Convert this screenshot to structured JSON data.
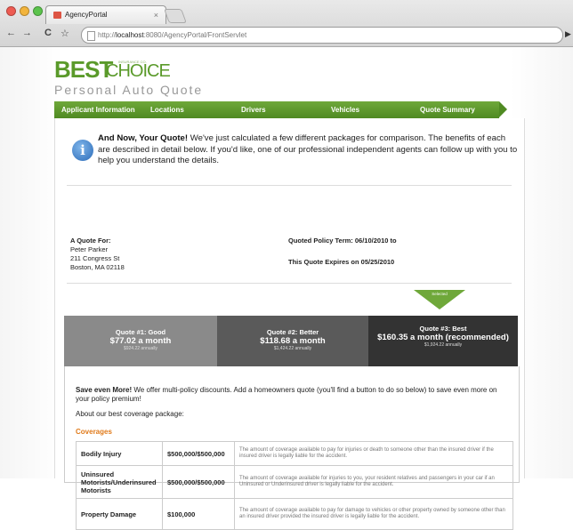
{
  "browser": {
    "tab_title": "AgencyPortal",
    "tab_close": "×",
    "back": "←",
    "forward": "→",
    "reload": "C",
    "star": "☆",
    "url_scheme": "http://",
    "url_host": "localhost",
    "url_rest": ":8080/AgencyPortal/FrontServlet",
    "go": "▶"
  },
  "brand": {
    "best": "BEST",
    "choice": "CHOICE",
    "tagline_small": "INSURANCE CO.",
    "subtitle": "Personal Auto Quote"
  },
  "nav": [
    "Applicant Information",
    "Locations",
    "Drivers",
    "Vehicles",
    "Quote Summary"
  ],
  "intro": {
    "bold": "And Now, Your Quote!",
    "text": " We've just calculated a few different packages for comparison. The benefits of each are described in detail below. If you'd like, one of our professional independent agents can follow up with you to help you understand the details."
  },
  "quote_for": {
    "label": "A Quote For:",
    "name": "Peter Parker",
    "street": "211 Congress St",
    "city": "Boston, MA 02118"
  },
  "policy_term": "Quoted Policy Term: 06/10/2010 to",
  "expires": "This Quote Expires on 05/25/2010",
  "selected_label": "Selected",
  "quotes": [
    {
      "title": "Quote #1: Good",
      "price": "$77.02 a month",
      "annual": "$924.22 annually"
    },
    {
      "title": "Quote #2: Better",
      "price": "$118.68 a month",
      "annual": "$1,424.22 annually"
    },
    {
      "title": "Quote #3: Best",
      "price": "$160.35 a month (recommended)",
      "annual": "$1,924.22 annually"
    }
  ],
  "save": {
    "bold": "Save even More!",
    "text": " We offer multi-policy discounts. Add a homeowners quote (you'll find a button to do so below) to save even more on your policy premium!"
  },
  "about": "About our best coverage package:",
  "coverages_heading": "Coverages",
  "coverages": [
    {
      "name": "Bodily Injury",
      "amount": "$500,000/$500,000",
      "desc": "The amount of coverage available to pay for injuries or death to someone other than the insured driver if the insured driver is legally liable for the accident."
    },
    {
      "name": "Uninsured Motorists/Underinsured Motorists",
      "amount": "$500,000/$500,000",
      "desc": "The amount of coverage available for injuries to you, your resident relatives and passengers in your car if an Uninsured or Underinsured driver is legally liable for the accident."
    },
    {
      "name": "Property Damage",
      "amount": "$100,000",
      "desc": "The amount of coverage available to pay for damage to vehicles or other property owned by someone other than an insured driver provided the insured driver is legally liable for the accident."
    }
  ],
  "colors": {
    "brand_green": "#5a9a2a",
    "nav_green": "#4f8a22",
    "accent_orange": "#e07a1a",
    "info_blue": "#2b6bb8",
    "quote1_bg": "#8a8a8a",
    "quote2_bg": "#5a5a5a",
    "quote3_bg": "#333333"
  }
}
